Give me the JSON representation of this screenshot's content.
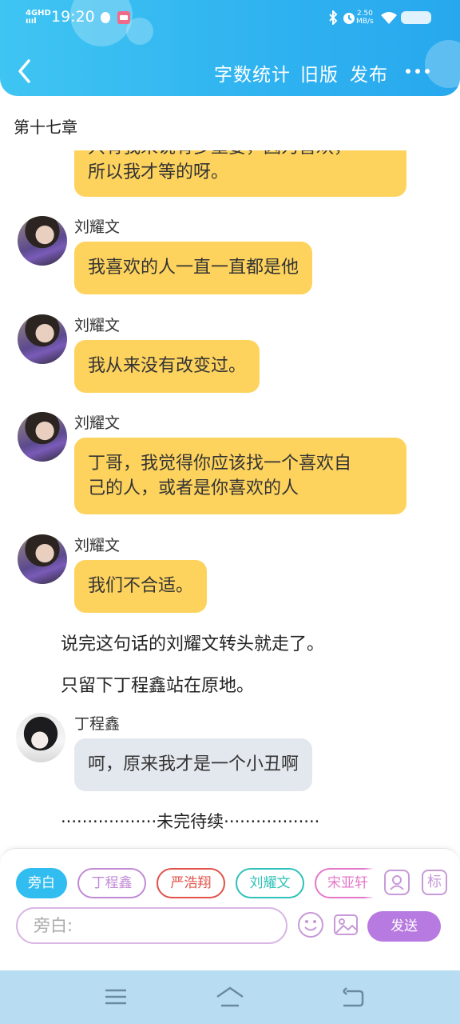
{
  "status_bar": {
    "network": "4GHD",
    "signal_bars": "ıııl",
    "time": "19:20",
    "speed_value": "2.50",
    "speed_unit": "MB/s"
  },
  "header": {
    "nav_links": [
      "字数统计",
      "旧版",
      "发布"
    ]
  },
  "chapter": {
    "title": "第十七章"
  },
  "messages": [
    {
      "type": "bubble",
      "variant": "yellow",
      "sender": "",
      "lines": [
        "只有我来说有多重要，因为喜欢，",
        "所以我才等的呀。"
      ]
    },
    {
      "type": "bubble",
      "variant": "yellow",
      "sender": "刘耀文",
      "lines": [
        "我喜欢的人一直一直都是他"
      ]
    },
    {
      "type": "bubble",
      "variant": "yellow",
      "sender": "刘耀文",
      "lines": [
        "我从来没有改变过。"
      ]
    },
    {
      "type": "bubble",
      "variant": "yellow",
      "sender": "刘耀文",
      "lines": [
        "丁哥，我觉得你应该找一个喜欢自",
        "己的人，或者是你喜欢的人"
      ]
    },
    {
      "type": "bubble",
      "variant": "yellow",
      "sender": "刘耀文",
      "lines": [
        "我们不合适。"
      ]
    },
    {
      "type": "narration",
      "text": "说完这句话的刘耀文转头就走了。"
    },
    {
      "type": "narration",
      "text": "只留下丁程鑫站在原地。"
    },
    {
      "type": "bubble",
      "variant": "gray",
      "sender": "丁程鑫",
      "lines": [
        "呵，原来我才是一个小丑啊"
      ]
    },
    {
      "type": "narration",
      "text": "··················未完待续··················"
    }
  ],
  "panel": {
    "chips": [
      {
        "label": "旁白",
        "color": "#32bdf0",
        "active": true
      },
      {
        "label": "丁程鑫",
        "color": "#c08ad6",
        "active": false
      },
      {
        "label": "严浩翔",
        "color": "#e0524a",
        "active": false
      },
      {
        "label": "刘耀文",
        "color": "#2fc1b8",
        "active": false
      },
      {
        "label": "宋亚轩",
        "color": "#e477c8",
        "active": false
      }
    ],
    "tag_label": "标",
    "input_placeholder": "旁白:",
    "send_label": "发送"
  },
  "colors": {
    "header": "#2fb2f0",
    "bubble_yellow": "#fdd35e",
    "bubble_gray": "#e3e7ee",
    "send": "#b77ae0",
    "navbar": "#b8dcf2"
  }
}
